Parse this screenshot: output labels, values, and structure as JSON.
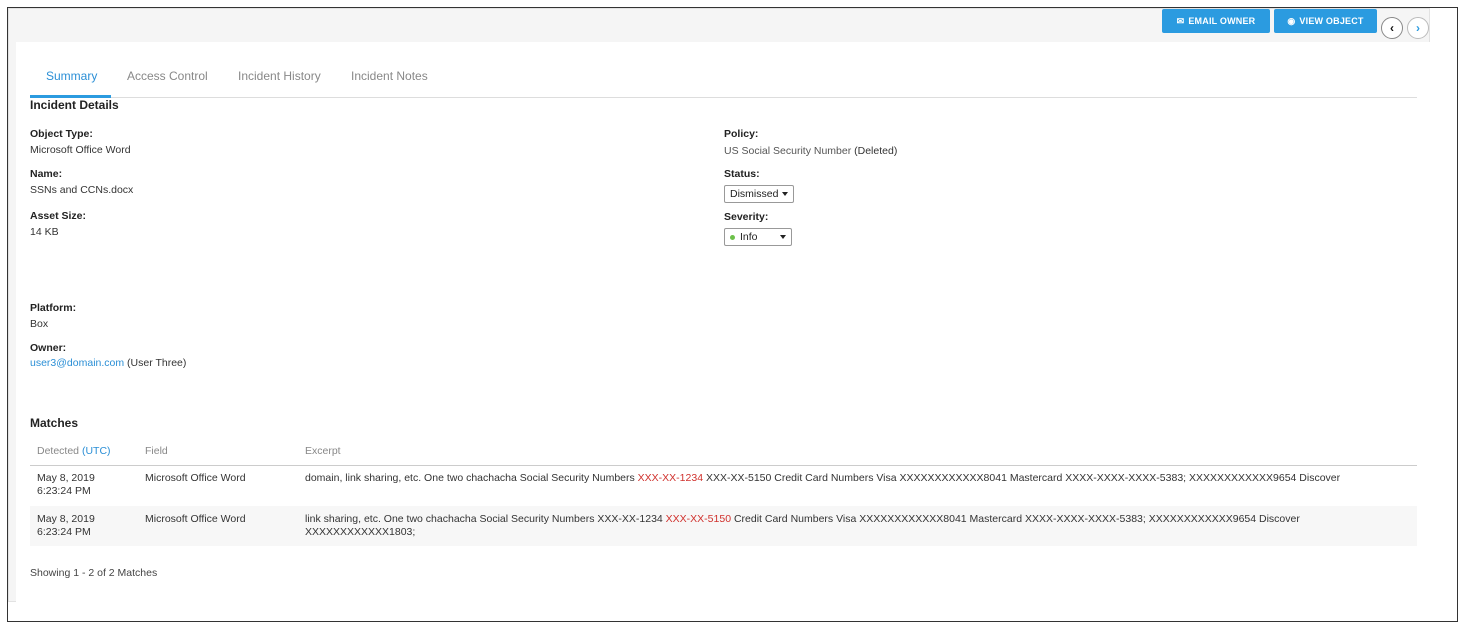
{
  "toolbar": {
    "email_owner_label": "EMAIL OWNER",
    "view_object_label": "VIEW OBJECT",
    "prev_glyph": "‹",
    "next_glyph": "›"
  },
  "tabs": [
    {
      "label": "Summary",
      "active": true
    },
    {
      "label": "Access Control",
      "active": false
    },
    {
      "label": "Incident History",
      "active": false
    },
    {
      "label": "Incident Notes",
      "active": false
    }
  ],
  "incident_details": {
    "title": "Incident Details",
    "object_type": {
      "label": "Object Type:",
      "value": "Microsoft Office Word"
    },
    "name": {
      "label": "Name:",
      "value": "SSNs and CCNs.docx"
    },
    "asset_size": {
      "label": "Asset Size:",
      "value": "14 KB"
    },
    "platform": {
      "label": "Platform:",
      "value": "Box"
    },
    "owner": {
      "label": "Owner:",
      "email": "user3@domain.com",
      "name": "(User Three)"
    },
    "policy": {
      "label": "Policy:",
      "value": "US Social Security Number",
      "status": "(Deleted)"
    },
    "status": {
      "label": "Status:",
      "selected": "Dismissed"
    },
    "severity": {
      "label": "Severity:",
      "selected": "Info",
      "indicator_color": "#6cc04a"
    }
  },
  "matches": {
    "title": "Matches",
    "columns": {
      "detected": "Detected",
      "detected_tz": "(UTC)",
      "field": "Field",
      "excerpt": "Excerpt"
    },
    "rows": [
      {
        "date": "May 8, 2019",
        "time": "6:23:24 PM",
        "field": "Microsoft Office Word",
        "excerpt_before": "domain, link sharing, etc. One two chachacha Social Security Numbers ",
        "excerpt_match": "XXX-XX-1234",
        "excerpt_after": " XXX-XX-5150 Credit Card Numbers Visa XXXXXXXXXXXX8041 Mastercard XXXX-XXXX-XXXX-5383; XXXXXXXXXXXX9654 Discover"
      },
      {
        "date": "May 8, 2019",
        "time": "6:23:24 PM",
        "field": "Microsoft Office Word",
        "excerpt_before": "link sharing, etc. One two chachacha Social Security Numbers XXX-XX-1234 ",
        "excerpt_match": "XXX-XX-5150",
        "excerpt_after": " Credit Card Numbers Visa XXXXXXXXXXXX8041 Mastercard XXXX-XXXX-XXXX-5383; XXXXXXXXXXXX9654 Discover XXXXXXXXXXXX1803;"
      }
    ],
    "footer": "Showing 1 - 2 of 2 Matches"
  },
  "colors": {
    "accent": "#2b9be0",
    "match_highlight": "#d0312d",
    "link": "#2b8fd6"
  }
}
